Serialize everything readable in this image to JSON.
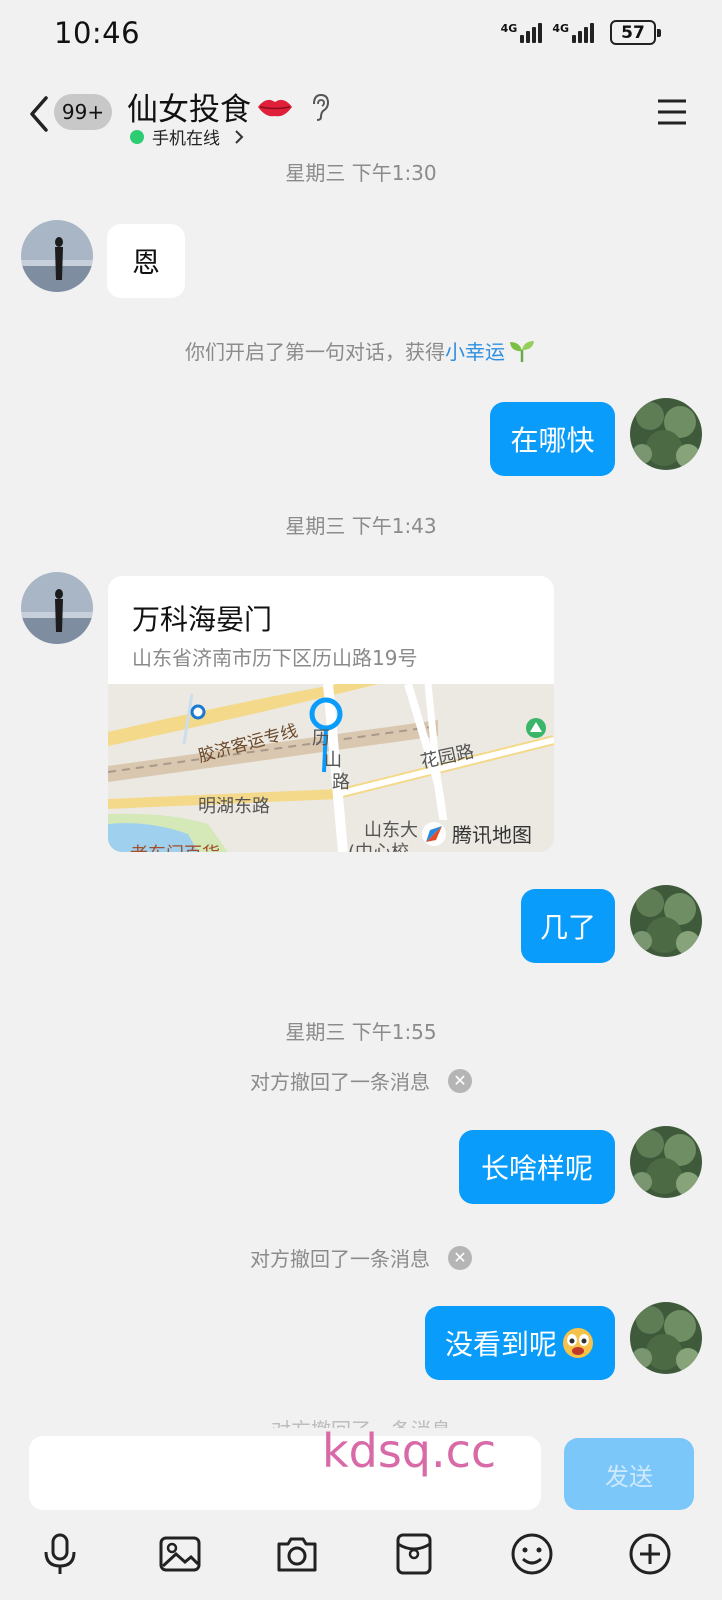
{
  "status_bar": {
    "time": "10:46",
    "net1": "4G",
    "net2": "4G",
    "battery": "57"
  },
  "header": {
    "unread_badge": "99+",
    "contact_name": "仙女投食",
    "online_status": "手机在线"
  },
  "messages": {
    "ts1": "星期三 下午1:30",
    "in1": "恩",
    "sys1_prefix": "你们开启了第一句对话，获得",
    "sys1_link": "小幸运",
    "out1": "在哪快",
    "ts2": "星期三 下午1:43",
    "location": {
      "name": "万科海晏门",
      "address": "山东省济南市历下区历山路19号",
      "map_labels": {
        "rail": "胶济客运专线",
        "road1": "花园路",
        "road2": "明湖东路",
        "road3": "历",
        "road4": "山",
        "road5": "路",
        "poi": "山东大",
        "poi2": "(中心校",
        "poi3": "老东门百货",
        "brand": "腾讯地图"
      }
    },
    "out2": "几了",
    "ts3": "星期三 下午1:55",
    "sys2": "对方撤回了一条消息",
    "out3": "长啥样呢",
    "sys3": "对方撤回了一条消息",
    "out4": "没看到呢",
    "sys4_partial": "对方撤回了一条消息"
  },
  "input": {
    "placeholder": "",
    "send_label": "发送"
  },
  "watermark": "kdsq.cc",
  "colors": {
    "accent": "#0a9cfb",
    "online": "#2ecc71",
    "send_disabled": "#7cc7fa"
  }
}
